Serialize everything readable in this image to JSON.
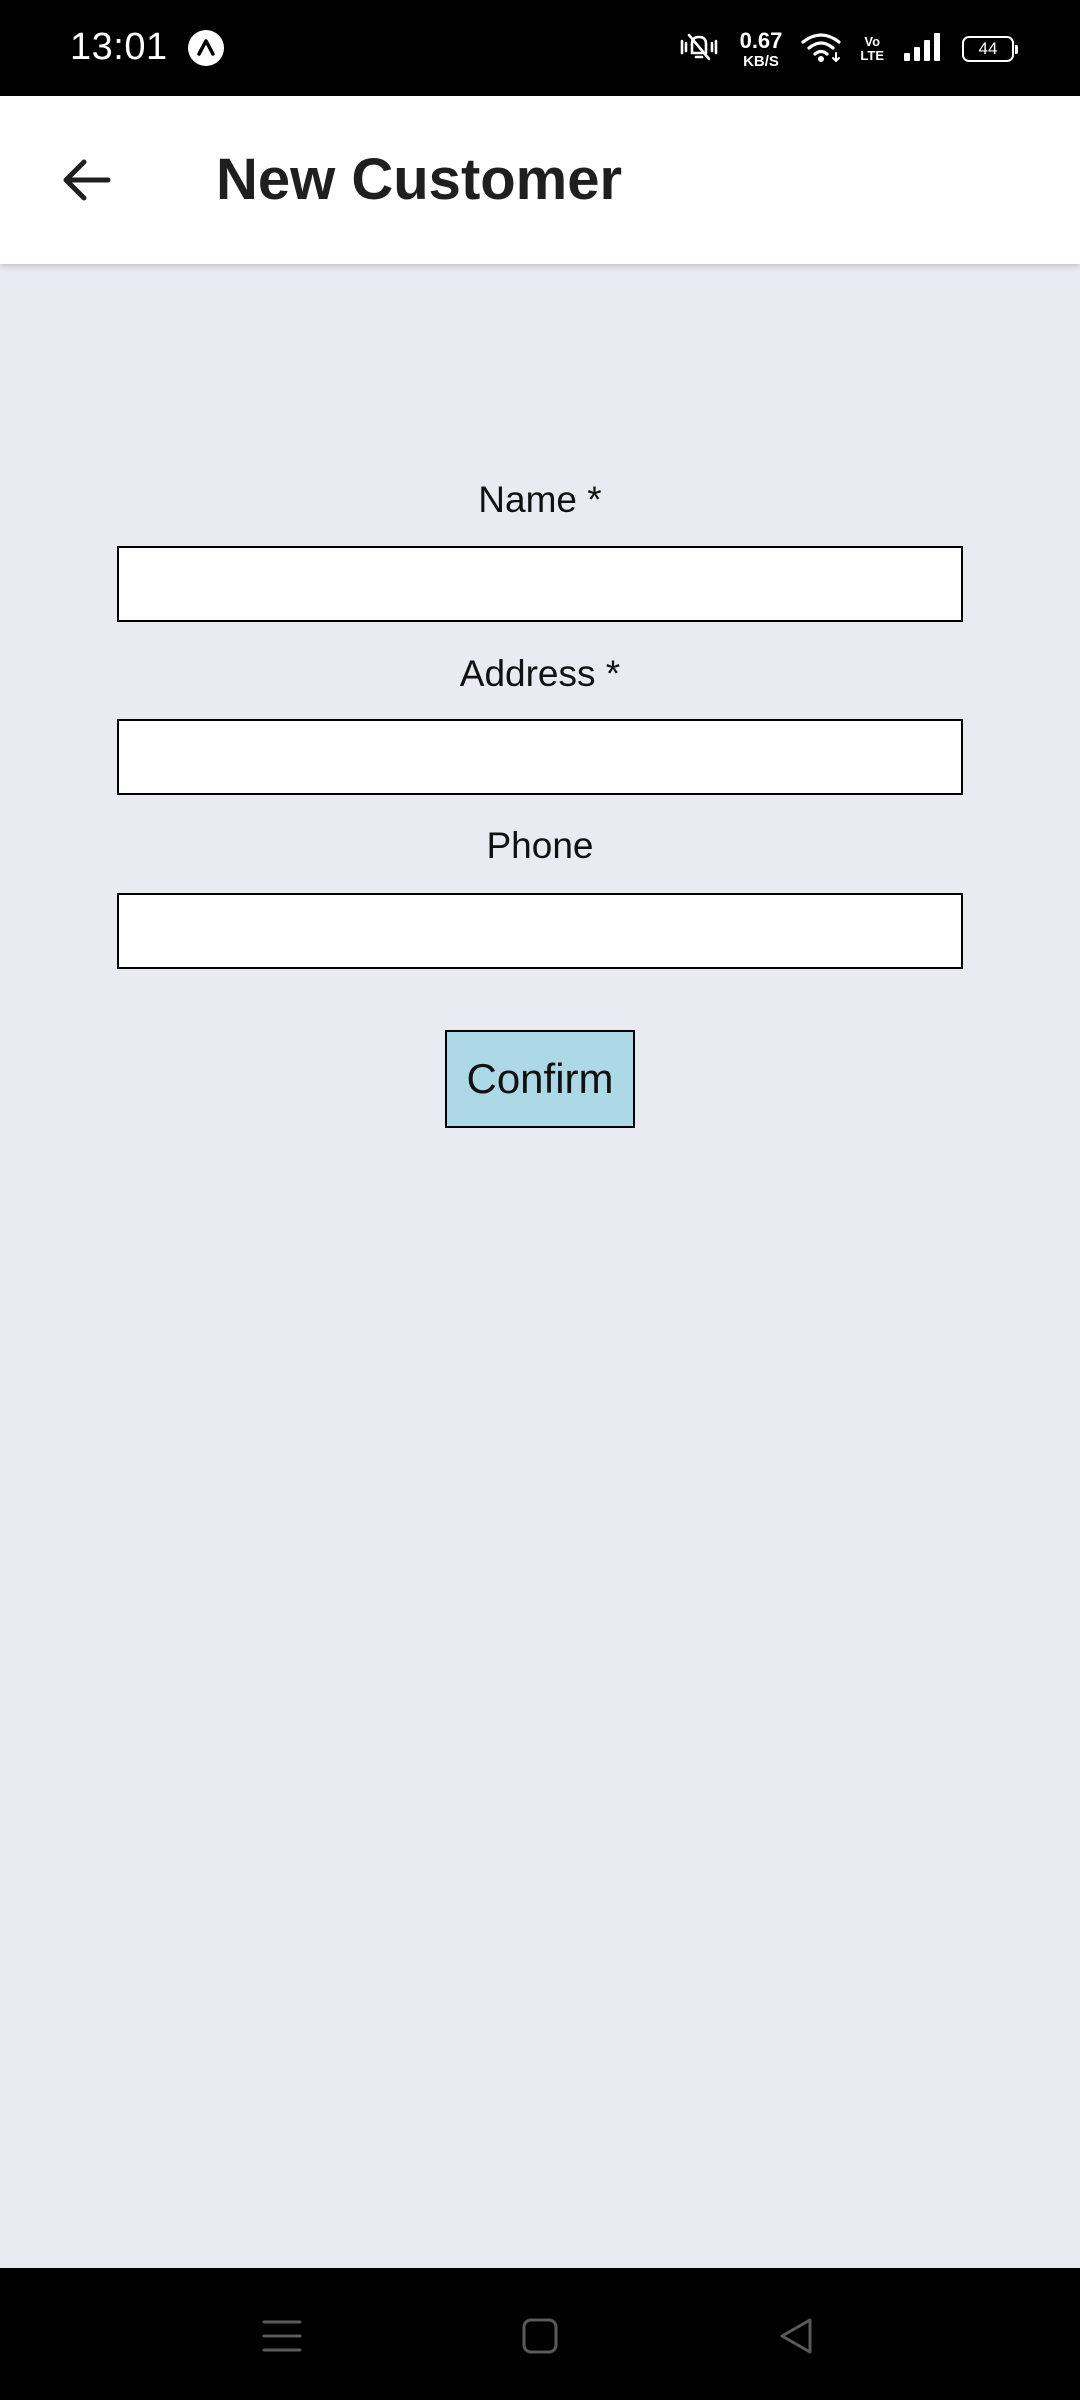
{
  "status_bar": {
    "time": "13:01",
    "net_speed_value": "0.67",
    "net_speed_unit": "KB/S",
    "volte_top": "Vo",
    "volte_bottom": "LTE",
    "battery": "44",
    "icons": [
      "app-notification-icon",
      "vibrate-icon",
      "wifi-icon",
      "signal-icon",
      "battery-icon"
    ]
  },
  "app_bar": {
    "title": "New Customer",
    "back_icon": "arrow-back-icon"
  },
  "form": {
    "fields": [
      {
        "label": "Name *",
        "value": "",
        "placeholder": ""
      },
      {
        "label": "Address *",
        "value": "",
        "placeholder": ""
      },
      {
        "label": "Phone",
        "value": "",
        "placeholder": ""
      }
    ],
    "confirm_label": "Confirm"
  },
  "nav_bar": {
    "icons": [
      "menu-icon",
      "home-icon",
      "back-triangle-icon"
    ]
  },
  "colors": {
    "background": "#eaeaf3",
    "app_bar": "#ffffff",
    "confirm_button": "#add8e6",
    "status_bar": "#000000"
  }
}
